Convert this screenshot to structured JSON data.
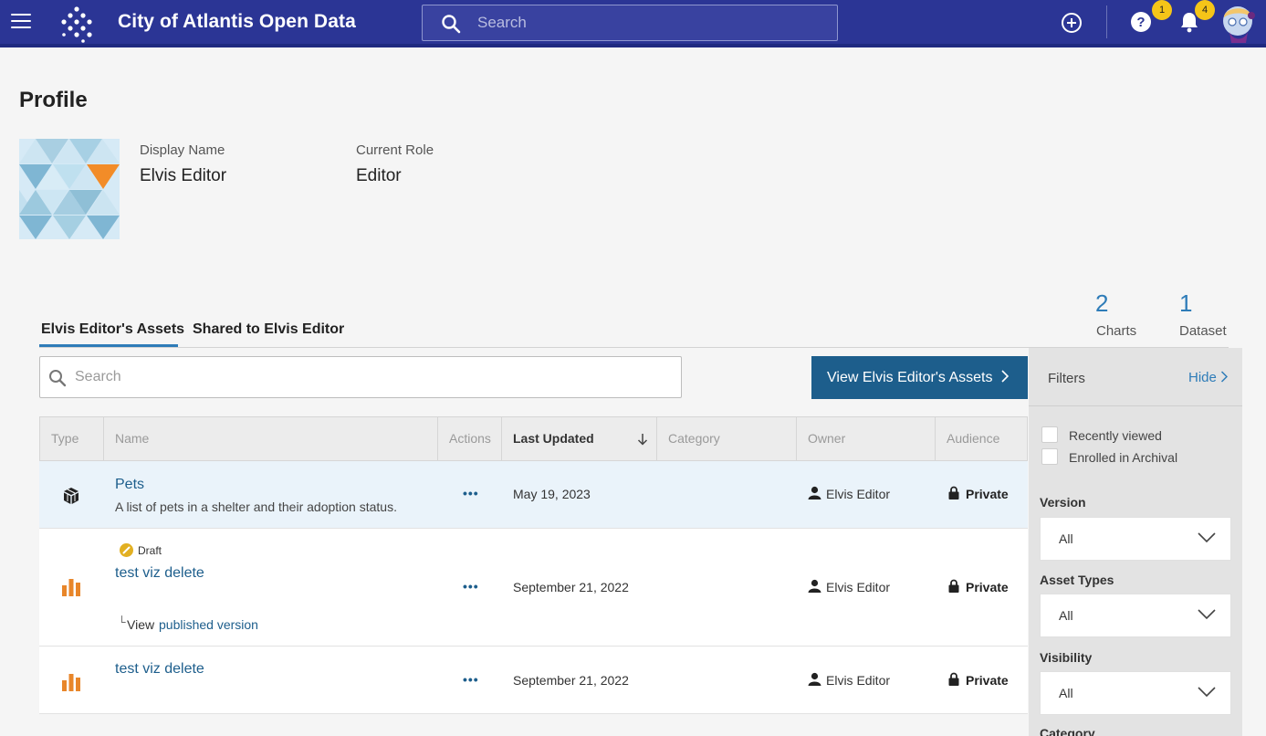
{
  "header": {
    "title": "City of Atlantis Open Data",
    "search_placeholder": "Search",
    "help_badge": "1",
    "notifications_badge": "4",
    "brand_color": "#2b3595"
  },
  "profile": {
    "page_title": "Profile",
    "display_name_label": "Display Name",
    "display_name": "Elvis Editor",
    "role_label": "Current Role",
    "role": "Editor"
  },
  "stats": [
    {
      "count": "2",
      "label": "Charts"
    },
    {
      "count": "1",
      "label": "Dataset"
    }
  ],
  "tabs": [
    {
      "label": "Elvis Editor's Assets",
      "active": true
    },
    {
      "label": "Shared to Elvis Editor",
      "active": false
    }
  ],
  "assets": {
    "search_placeholder": "Search",
    "view_button": "View Elvis Editor's Assets",
    "columns": [
      "Type",
      "Name",
      "Actions",
      "Last Updated",
      "Category",
      "Owner",
      "Audience"
    ],
    "rows": [
      {
        "type": "dataset-icon",
        "name": "Pets",
        "description": "A list of pets in a shelter and their adoption status.",
        "actions": "•••",
        "last_updated": "May 19, 2023",
        "category": "",
        "owner": "Elvis Editor",
        "audience": "Private"
      },
      {
        "type": "chart-icon",
        "draft_label": "Draft",
        "name": "test viz delete",
        "published_prefix": "└",
        "published_text_1": "View",
        "published_text_2": "published version",
        "actions": "•••",
        "last_updated": "September 21, 2022",
        "category": "",
        "owner": "Elvis Editor",
        "audience": "Private"
      },
      {
        "type": "chart-icon",
        "name": "test viz delete",
        "actions": "•••",
        "last_updated": "September 21, 2022",
        "category": "",
        "owner": "Elvis Editor",
        "audience": "Private"
      }
    ]
  },
  "filters": {
    "title": "Filters",
    "hide_label": "Hide",
    "checkboxes": [
      {
        "label": "Recently viewed",
        "checked": false
      },
      {
        "label": "Enrolled in Archival",
        "checked": false
      }
    ],
    "selects": [
      {
        "label": "Version",
        "value": "All"
      },
      {
        "label": "Asset Types",
        "value": "All"
      },
      {
        "label": "Visibility",
        "value": "All"
      }
    ],
    "next_label": "Category"
  }
}
